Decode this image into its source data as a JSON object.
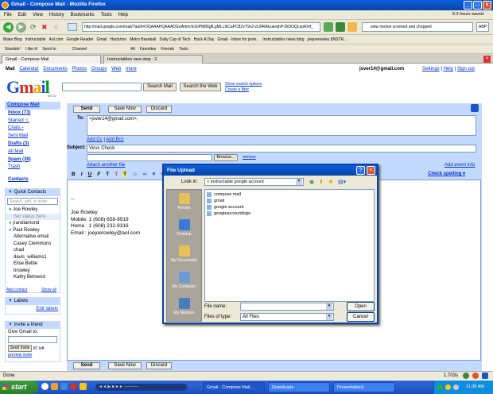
{
  "window": {
    "title": "Gmail - Compose Mail - Mozilla Firefox"
  },
  "menu": {
    "items": [
      "File",
      "Edit",
      "View",
      "History",
      "Bookmarks",
      "Tools",
      "Help"
    ],
    "saved": "9.3 hours saved"
  },
  "nav": {
    "url": "http://mail.google.com/mail/?auth=DQAAAHQAAADGoArtmcfcGIPM86gfLgMLL9iCaPC8ZvT9v2-zU0RAkcaeqhP-DiDOQLnpRmf_",
    "search": "slow motion screwed and chopped"
  },
  "bookmarks": [
    "Make Blog",
    "Instructable",
    "Aol.com",
    "Google Reader",
    "Gmail",
    "Hackzine",
    "Metro Baseball",
    "Daily Cup of Tech",
    "Hack A Day",
    "Gmail - Inbox for jsver...",
    "Instructables news blog",
    "joejoerowley [INSTR..."
  ],
  "stumble": {
    "items": [
      "Stumble!",
      "I like it!",
      "Send to",
      "Channel",
      "All",
      "Favorites",
      "Friends",
      "Tools"
    ]
  },
  "tabs": [
    {
      "label": "Gmail - Compose Mail"
    },
    {
      "label": "Instructables new step : 2"
    }
  ],
  "gmail": {
    "links": [
      "Mail",
      "Calendar",
      "Documents",
      "Photos",
      "Groups",
      "Web",
      "more"
    ],
    "email": "jsver14@gmail.com",
    "settings": "Settings",
    "help": "Help",
    "signout": "Sign out",
    "logo_beta": "BETA",
    "search_mail": "Search Mail",
    "search_web": "Search the Web",
    "show_options": "Show search options",
    "create_filter": "Create a filter"
  },
  "leftnav": {
    "compose": "Compose Mail",
    "items": [
      {
        "label": "Inbox (73)",
        "bold": true
      },
      {
        "label": "Starred",
        "bold": false
      },
      {
        "label": "Chats",
        "bold": false
      },
      {
        "label": "Sent Mail",
        "bold": false
      },
      {
        "label": "Drafts (3)",
        "bold": true
      },
      {
        "label": "All Mail",
        "bold": false
      },
      {
        "label": "Spam (39)",
        "bold": true
      },
      {
        "label": "Trash",
        "bold": false
      }
    ],
    "contacts": "Contacts",
    "quick_contacts": "Quick Contacts",
    "search_placeholder": "Search, add, or invite",
    "me": "Joe Rowley",
    "set_status": "Set status here",
    "contact_list": [
      "jrandiamond",
      "Paul Rowley",
      "Alternative email",
      "Casey Clemmons",
      "chad",
      "davis_williams1",
      "Elise Bettie",
      "hrowley",
      "Kathy Behrend"
    ],
    "add_contact": "Add contact",
    "show_all": "Show all",
    "labels": "Labels",
    "edit_labels": "Edit labels",
    "invite": "Invite a friend",
    "give_gmail": "Give Gmail to:",
    "send_invite": "Send Invite",
    "invites_left": "87 left",
    "preview_invite": "preview invite"
  },
  "compose": {
    "send": "Send",
    "save": "Save Now",
    "discard": "Discard",
    "to_label": "To:",
    "to_value": "<jsver14@gmail.com>,",
    "add_cc": "Add Cc",
    "add_bcc": "Add Bcc",
    "subject_label": "Subject:",
    "subject_value": "Virus Check",
    "browse": "Browse...",
    "remove": "remove",
    "attach_another": "Attach another file",
    "add_event": "Add event info",
    "check_spelling": "Check spelling",
    "body": [
      "--",
      "",
      "Joe Rowley",
      "Mobile: 1 (608) 658-9919",
      "Home : 1 (608) 232-9316",
      "Email : joejoerowley@aol.com"
    ]
  },
  "dialog": {
    "title": "File Upload",
    "look_in_label": "Look in:",
    "look_in_value": "instructable google account",
    "places": [
      "Recent",
      "Desktop",
      "My Documents",
      "My Computer",
      "My Network"
    ],
    "files": [
      "compose mail",
      "gmail",
      "google account",
      "googleaccountlogo"
    ],
    "filename_label": "File name:",
    "filename_value": "",
    "filetype_label": "Files of type:",
    "filetype_value": "All Files",
    "open": "Open",
    "cancel": "Cancel"
  },
  "status": {
    "text": "Done",
    "right": "1.703s"
  },
  "taskbar": {
    "start": "start",
    "items": [
      "Gmail - Compose Mail ...",
      "Downloads",
      "Presentation1"
    ],
    "clock": "11:38 AM"
  }
}
